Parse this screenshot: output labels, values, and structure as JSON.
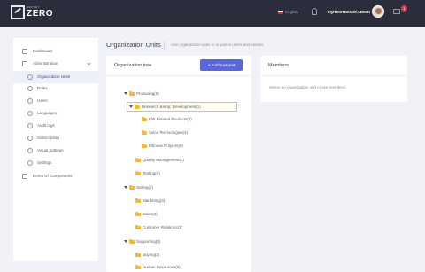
{
  "topbar": {
    "brand_small": "ASP.NET",
    "brand": "ZERO",
    "language": "English",
    "username": "JQ\\TESTDEMO\\ADMIN",
    "notification_count": "1"
  },
  "sidebar": {
    "items": [
      {
        "label": "Dashboard"
      },
      {
        "label": "Administration"
      },
      {
        "label": "Organization Units"
      },
      {
        "label": "Roles"
      },
      {
        "label": "Users"
      },
      {
        "label": "Languages"
      },
      {
        "label": "Audit logs"
      },
      {
        "label": "Subscription"
      },
      {
        "label": "Visual Settings"
      },
      {
        "label": "Settings"
      },
      {
        "label": "Demo UI Components"
      }
    ]
  },
  "header": {
    "title": "Organization Units",
    "description": "Use organization units to organize users and entities"
  },
  "tree": {
    "title": "Organization tree",
    "add_button": "Add root unit",
    "nodes": [
      {
        "label": "Producing(0)"
      },
      {
        "label": "Research &amp; Development(1)"
      },
      {
        "label": "IVR Related Products(3)"
      },
      {
        "label": "Voice Technologies(3)"
      },
      {
        "label": "Inhouse Projects(0)"
      },
      {
        "label": "Quality Management(4)"
      },
      {
        "label": "Testing(0)"
      },
      {
        "label": "Selling(2)"
      },
      {
        "label": "Marketing(3)"
      },
      {
        "label": "Sales(2)"
      },
      {
        "label": "Customer Relations(2)"
      },
      {
        "label": "Supporting(0)"
      },
      {
        "label": "Buying(2)"
      },
      {
        "label": "Human Resources(0)"
      }
    ]
  },
  "members": {
    "title": "Members",
    "hint": "Select an organization unit to see members."
  },
  "colors": {
    "topbar": "#2b2d3c",
    "accent": "#5867dd",
    "folder": "#f3b93b",
    "background": "#f1f2f7"
  }
}
